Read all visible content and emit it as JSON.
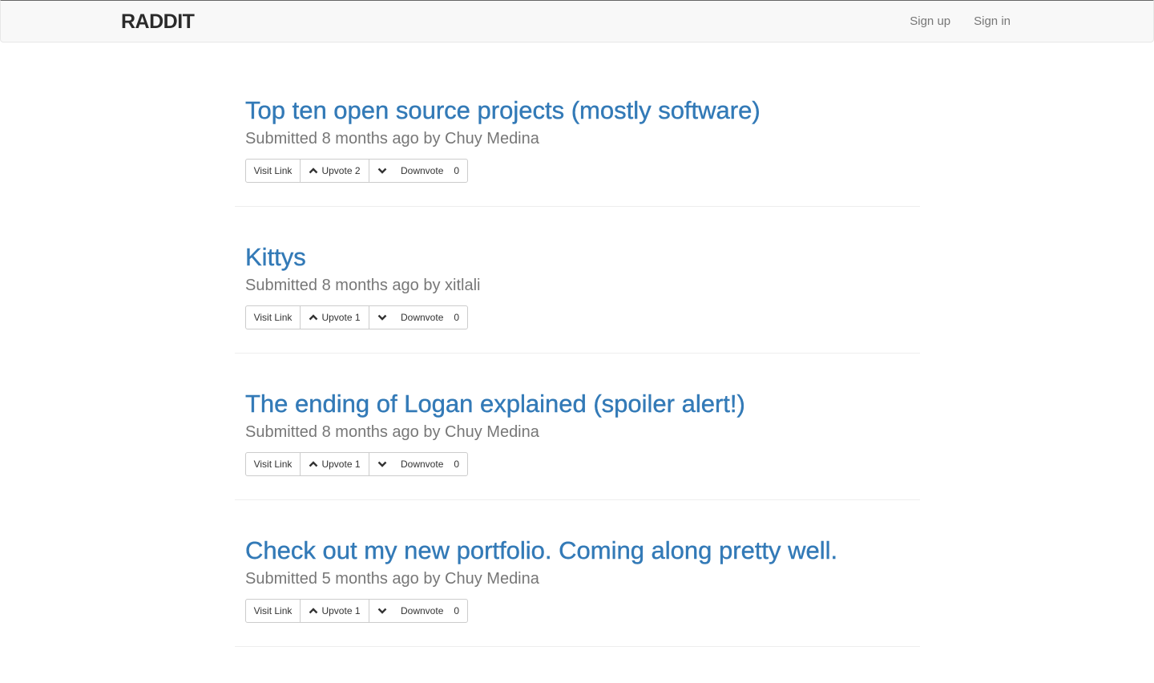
{
  "navbar": {
    "brand": "RADDIT",
    "links": [
      {
        "label": "Sign up"
      },
      {
        "label": "Sign in"
      }
    ]
  },
  "buttons": {
    "visit": "Visit Link",
    "upvote": "Upvote",
    "downvote": "Downvote"
  },
  "posts": [
    {
      "title": "Top ten open source projects (mostly software)",
      "meta": "Submitted 8 months ago by Chuy Medina",
      "upvotes": "2",
      "downvotes": "0"
    },
    {
      "title": "Kittys",
      "meta": "Submitted 8 months ago by xitlali",
      "upvotes": "1",
      "downvotes": "0"
    },
    {
      "title": "The ending of Logan explained (spoiler alert!)",
      "meta": "Submitted 8 months ago by Chuy Medina",
      "upvotes": "1",
      "downvotes": "0"
    },
    {
      "title": "Check out my new portfolio. Coming along pretty well.",
      "meta": "Submitted 5 months ago by Chuy Medina",
      "upvotes": "1",
      "downvotes": "0"
    }
  ]
}
